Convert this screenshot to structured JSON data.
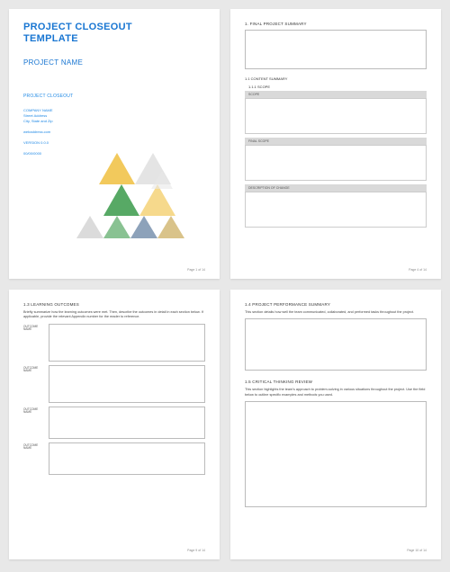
{
  "cover": {
    "title_line1": "PROJECT CLOSEOUT",
    "title_line2": "TEMPLATE",
    "project_name": "PROJECT NAME",
    "closeout_label": "PROJECT CLOSEOUT",
    "company_name": "COMPANY NAME",
    "street": "Street Address",
    "city_state_zip": "City, State and Zip",
    "web": "webaddress.com",
    "version": "VERSION 0.0.0",
    "date": "00/00/0000",
    "footer": "Page 1 of 14"
  },
  "page2": {
    "h1": "1.   FINAL PROJECT SUMMARY",
    "h2": "1.1   CONTENT SUMMARY",
    "h3": "1.1.1   SCOPE",
    "scope_label": "SCOPE",
    "final_scope_label": "FINAL SCOPE",
    "desc_change_label": "DESCRIPTION OF CHANGE",
    "footer": "Page 4 of 14"
  },
  "page3": {
    "h1": "1.3   LEARNING OUTCOMES",
    "intro": "Briefly summarize how the learning outcomes were met. Then, describe the outcomes in detail in each section below. If applicable, provide the relevant Appendix number for the reader to reference.",
    "outcome_label": "OUTCOME NAME",
    "footer": "Page 9 of 14"
  },
  "page4": {
    "h1": "1.4   PROJECT PERFORMANCE SUMMARY",
    "intro1": "This section details how well the team communicated, collaborated, and performed tasks throughout the project.",
    "h2": "1.5   CRITICAL THINKING REVIEW",
    "intro2": "This section highlights the team's approach to problem-solving in various situations throughout the project. Use the field below to outline specific examples and methods you used.",
    "footer": "Page 10 of 14"
  }
}
